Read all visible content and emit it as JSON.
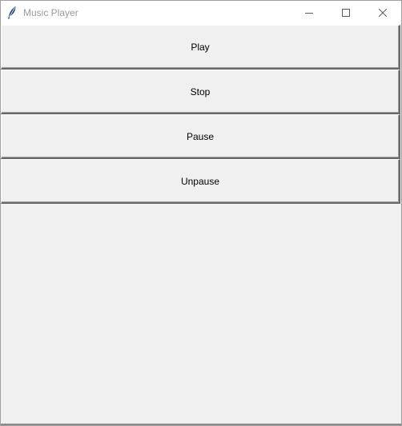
{
  "window": {
    "title": "Music Player",
    "icon": "feather-icon",
    "controls": [
      "minimize-icon",
      "maximize-icon",
      "close-icon"
    ]
  },
  "buttons": [
    {
      "label": "Play"
    },
    {
      "label": "Stop"
    },
    {
      "label": "Pause"
    },
    {
      "label": "Unpause"
    }
  ],
  "colors": {
    "titlebar": "#ffffff",
    "title_text": "#9a9a9a",
    "client_background": "#f0f0f0",
    "button_face": "#f0f0f0",
    "button_text": "#000000",
    "icon": "#1f3c7a"
  }
}
